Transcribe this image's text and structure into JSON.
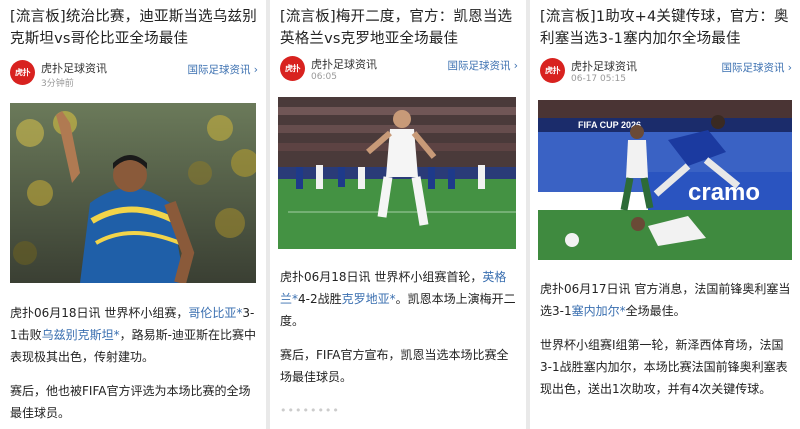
{
  "cards": [
    {
      "title": "[流言板]统治比赛，迪亚斯当选乌兹别克斯坦vs哥伦比亚全场最佳",
      "source": "虎扑足球资讯",
      "time": "3分钟前",
      "tag": "国际足球资讯",
      "logo_text": "虎扑",
      "p1_a": "虎扑06月18日讯 世界杯小组赛，",
      "p1_link1": "哥伦比亚*",
      "p1_b": "3-1击败",
      "p1_link2": "乌兹别克斯坦*",
      "p1_c": "，路易斯-迪亚斯在比赛中表现极其出色，传射建功。",
      "p2": "赛后，他也被FIFA官方评选为本场比赛的全场最佳球员。"
    },
    {
      "title": "[流言板]梅开二度，官方：凯恩当选英格兰vs克罗地亚全场最佳",
      "source": "虎扑足球资讯",
      "time": "06:05",
      "tag": "国际足球资讯",
      "logo_text": "虎扑",
      "p1_a": "虎扑06月18日讯 世界杯小组赛首轮，",
      "p1_link1": "英格兰*",
      "p1_b": "4-2战胜",
      "p1_link2": "克罗地亚*",
      "p1_c": "。凯恩本场上演梅开二度。",
      "p2": "赛后，FIFA官方宣布，凯恩当选本场比赛全场最佳球员。",
      "footer_dots": "••••••••"
    },
    {
      "title": "[流言板]1助攻+4关键传球，官方：奥利塞当选3-1塞内加尔全场最佳",
      "source": "虎扑足球资讯",
      "time": "06-17 05:15",
      "tag": "国际足球资讯",
      "logo_text": "虎扑",
      "p1_a": "虎扑06月17日讯 官方消息，法国前锋奥利塞当选3-1",
      "p1_link1": "塞内加尔*",
      "p1_c": "全场最佳。",
      "p2": "世界杯小组赛I组第一轮，新泽西体育场，法国3-1战胜塞内加尔，本场比赛法国前锋奥利塞表现出色，送出1次助攻，并有4次关键传球。",
      "banner_text": "FIFA CUP 2026",
      "board_text": "cramo"
    }
  ]
}
